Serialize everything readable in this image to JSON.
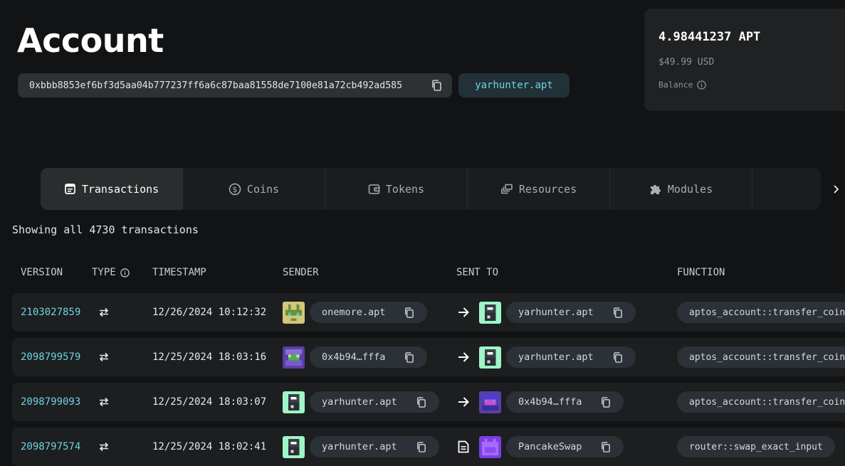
{
  "page": {
    "title": "Account",
    "address": "0xbbb8853ef6bf3d5aa04b777237ff6a6c87baa81558de7100e81a72cb492ad585",
    "ans_name": "yarhunter.apt"
  },
  "balance": {
    "apt": "4.98441237 APT",
    "usd": "$49.99 USD",
    "label": "Balance"
  },
  "tabs": [
    {
      "label": "Transactions",
      "icon": "receipt-icon",
      "active": true
    },
    {
      "label": "Coins",
      "icon": "dollar-coin-icon"
    },
    {
      "label": "Tokens",
      "icon": "wallet-icon"
    },
    {
      "label": "Resources",
      "icon": "layers-icon"
    },
    {
      "label": "Modules",
      "icon": "puzzle-icon"
    },
    {
      "label": "",
      "icon": "document-icon"
    }
  ],
  "summary": "Showing all 4730 transactions",
  "table": {
    "headers": {
      "version": "VERSION",
      "type": "TYPE",
      "timestamp": "TIMESTAMP",
      "sender": "SENDER",
      "sent_to": "SENT TO",
      "function": "FUNCTION"
    },
    "rows": [
      {
        "version": "2103027859",
        "timestamp": "12/26/2024 10:12:32",
        "sender": "onemore.apt",
        "sent_to_icon": "arrow-right-icon",
        "recipient": "yarhunter.apt",
        "function": "aptos_account::transfer_coins"
      },
      {
        "version": "2098799579",
        "timestamp": "12/25/2024 18:03:16",
        "sender": "0x4b94…fffa",
        "sent_to_icon": "arrow-right-icon",
        "recipient": "yarhunter.apt",
        "function": "aptos_account::transfer_coins"
      },
      {
        "version": "2098799093",
        "timestamp": "12/25/2024 18:03:07",
        "sender": "yarhunter.apt",
        "sent_to_icon": "arrow-right-icon",
        "recipient": "0x4b94…fffa",
        "function": "aptos_account::transfer_coins"
      },
      {
        "version": "2098797574",
        "timestamp": "12/25/2024 18:02:41",
        "sender": "yarhunter.apt",
        "sent_to_icon": "contract-document-icon",
        "recipient": "PancakeSwap",
        "function": "router::swap_exact_input"
      }
    ]
  },
  "colors": {
    "background": "#121315",
    "accent": "#6fd3e0",
    "card": "#1f2123",
    "chip": "#2b3136"
  }
}
